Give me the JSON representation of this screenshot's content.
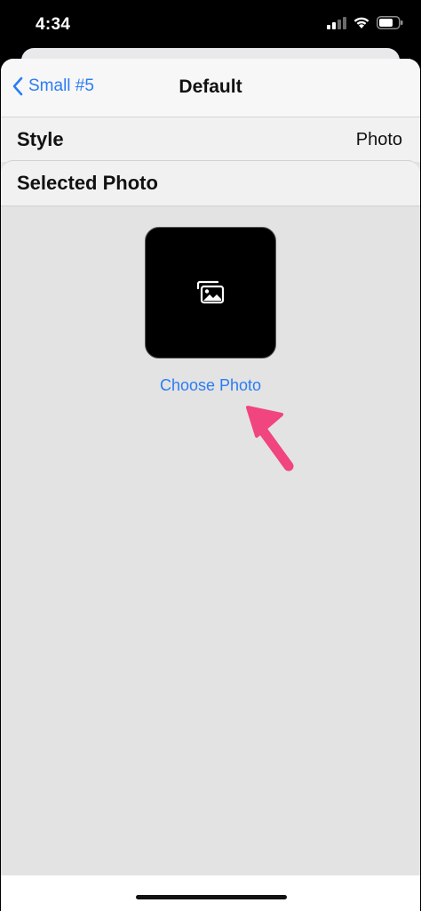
{
  "status_bar": {
    "time": "4:34",
    "icons": [
      "cellular-signal-icon",
      "wifi-icon",
      "battery-icon"
    ]
  },
  "nav": {
    "back_label": "Small #5",
    "title": "Default"
  },
  "style_row": {
    "label": "Style",
    "value": "Photo"
  },
  "selected_photo": {
    "header": "Selected Photo",
    "placeholder_icon": "photo-stack-icon",
    "choose_label": "Choose Photo"
  },
  "annotation": {
    "icon": "pointer-arrow-icon",
    "color": "#f0457f"
  },
  "colors": {
    "accent": "#2b7cf5",
    "sheet_bg": "#e3e3e3",
    "row_bg": "#f1f1f1"
  }
}
